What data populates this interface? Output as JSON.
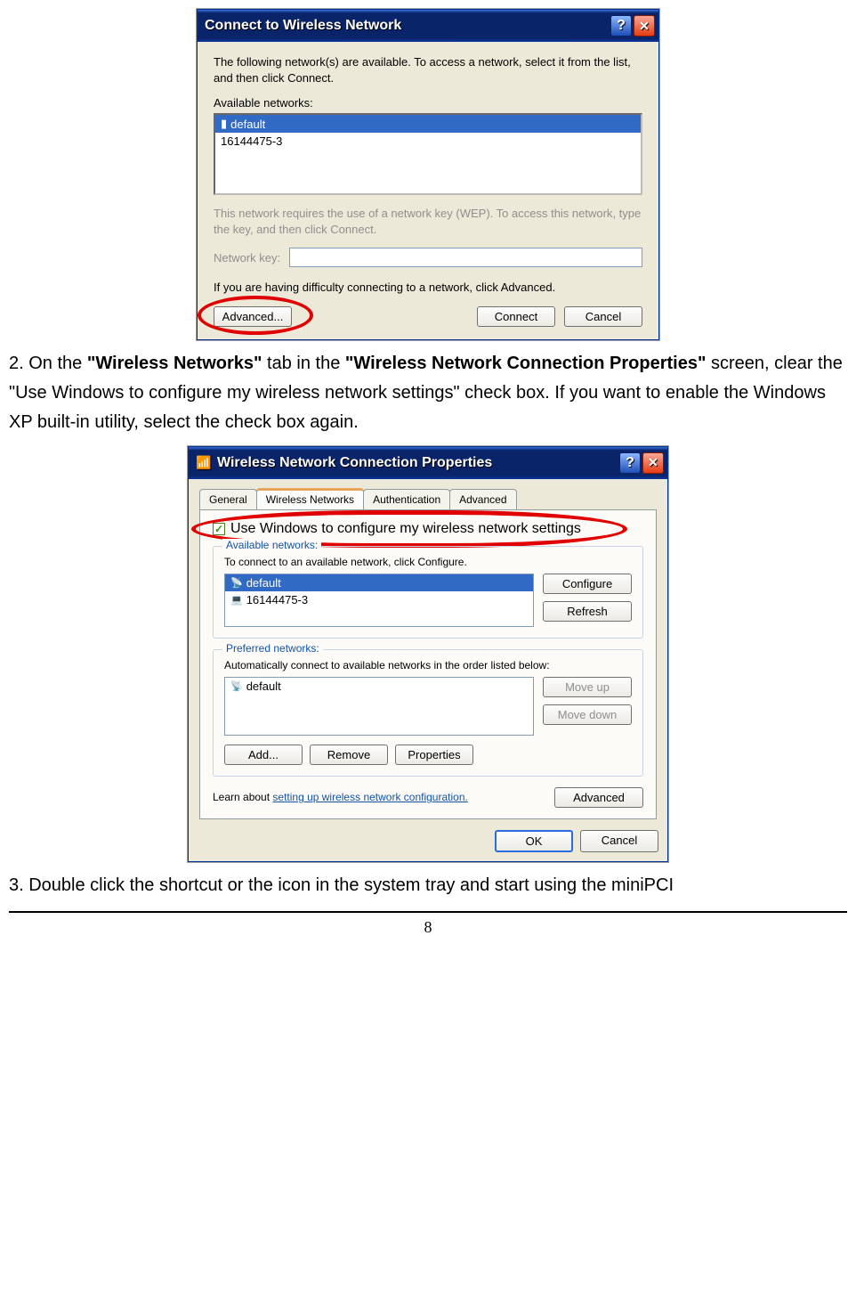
{
  "dialog1": {
    "title": "Connect to Wireless Network",
    "intro": "The following network(s) are available. To access a network, select it from the list, and then click Connect.",
    "available_label": "Available networks:",
    "networks": [
      {
        "name": "default",
        "selected": true
      },
      {
        "name": "16144475-3",
        "selected": false
      }
    ],
    "wep_note": "This network requires the use of a network key (WEP). To access this network, type the key, and then click Connect.",
    "key_label": "Network key:",
    "difficulty_note": "If you are having difficulty connecting to a network, click Advanced.",
    "buttons": {
      "advanced": "Advanced...",
      "connect": "Connect",
      "cancel": "Cancel"
    }
  },
  "doc_step2": {
    "prefix": "2. On the ",
    "bold1": "\"Wireless Networks\"",
    "mid1": " tab in the ",
    "bold2": "\"Wireless Network Connection Properties\"",
    "rest": " screen, clear the \"Use Windows to configure my wireless network settings\" check box. If you want to enable the Windows XP built-in utility, select the check box again."
  },
  "dialog2": {
    "title": "Wireless Network Connection Properties",
    "tabs": [
      "General",
      "Wireless Networks",
      "Authentication",
      "Advanced"
    ],
    "active_tab": 1,
    "checkbox_label": "Use Windows to configure my wireless network settings",
    "available": {
      "legend": "Available networks:",
      "desc": "To connect to an available network, click Configure.",
      "items": [
        {
          "name": "default",
          "selected": true
        },
        {
          "name": "16144475-3",
          "selected": false
        }
      ],
      "configure": "Configure",
      "refresh": "Refresh"
    },
    "preferred": {
      "legend": "Preferred networks:",
      "desc": "Automatically connect to available networks in the order listed below:",
      "items": [
        {
          "name": "default",
          "selected": false
        }
      ],
      "move_up": "Move up",
      "move_down": "Move down",
      "add": "Add...",
      "remove": "Remove",
      "properties": "Properties"
    },
    "learn_prefix": "Learn about ",
    "learn_link": "setting up wireless network configuration.",
    "advanced_btn": "Advanced",
    "ok": "OK",
    "cancel": "Cancel"
  },
  "doc_step3": "3. Double click the shortcut or the icon in the system tray and start using the miniPCI",
  "page_number": "8"
}
